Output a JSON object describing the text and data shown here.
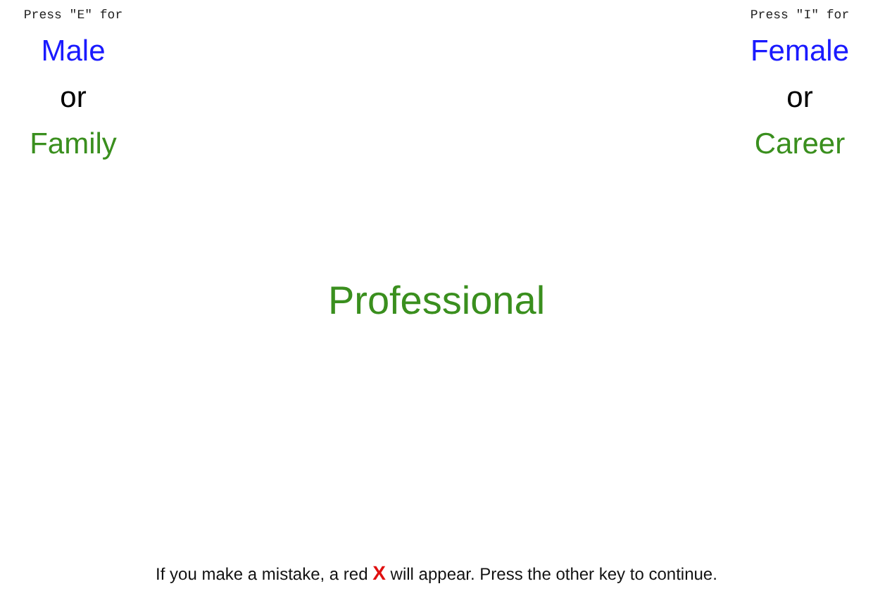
{
  "left_panel": {
    "hint": "Press \"E\" for",
    "labels": [
      {
        "text": "Male",
        "color": "#1a1aff"
      },
      {
        "text": "or",
        "color": "#000000"
      },
      {
        "text": "Family",
        "color": "#3a8f1e"
      }
    ]
  },
  "right_panel": {
    "hint": "Press \"I\" for",
    "labels": [
      {
        "text": "Female",
        "color": "#1a1aff"
      },
      {
        "text": "or",
        "color": "#000000"
      },
      {
        "text": "Career",
        "color": "#3a8f1e"
      }
    ]
  },
  "stimulus": {
    "text": "Professional",
    "color": "#3a8f1e"
  },
  "instructions": "If you make a mistake, a red **X** will appear. Press the other key to continue."
}
